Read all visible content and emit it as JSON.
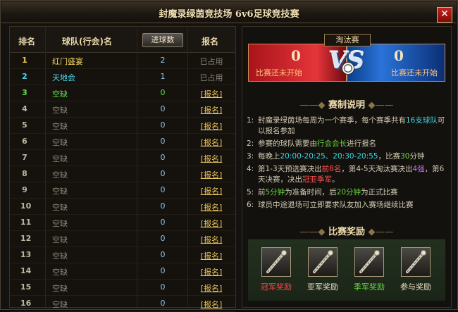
{
  "window": {
    "title": "封魔录绿茵竞技场 6v6足球竞技赛",
    "close_icon": "✕"
  },
  "table": {
    "headers": {
      "rank": "排名",
      "team": "球队(行会)名",
      "goals_btn": "进球数",
      "register": "报名"
    },
    "rows": [
      {
        "rank": "1",
        "team": "红门盛宴",
        "goals": "2",
        "reg": "已占用"
      },
      {
        "rank": "2",
        "team": "天地会",
        "goals": "1",
        "reg": "已占用"
      },
      {
        "rank": "3",
        "team": "空缺",
        "goals": "0",
        "reg": "[报名]"
      },
      {
        "rank": "4",
        "team": "空缺",
        "goals": "0",
        "reg": "[报名]"
      },
      {
        "rank": "5",
        "team": "空缺",
        "goals": "0",
        "reg": "[报名]"
      },
      {
        "rank": "6",
        "team": "空缺",
        "goals": "0",
        "reg": "[报名]"
      },
      {
        "rank": "7",
        "team": "空缺",
        "goals": "0",
        "reg": "[报名]"
      },
      {
        "rank": "8",
        "team": "空缺",
        "goals": "0",
        "reg": "[报名]"
      },
      {
        "rank": "9",
        "team": "空缺",
        "goals": "0",
        "reg": "[报名]"
      },
      {
        "rank": "10",
        "team": "空缺",
        "goals": "0",
        "reg": "[报名]"
      },
      {
        "rank": "11",
        "team": "空缺",
        "goals": "0",
        "reg": "[报名]"
      },
      {
        "rank": "12",
        "team": "空缺",
        "goals": "0",
        "reg": "[报名]"
      },
      {
        "rank": "13",
        "team": "空缺",
        "goals": "0",
        "reg": "[报名]"
      },
      {
        "rank": "14",
        "team": "空缺",
        "goals": "0",
        "reg": "[报名]"
      },
      {
        "rank": "15",
        "team": "空缺",
        "goals": "0",
        "reg": "[报名]"
      },
      {
        "rank": "16",
        "team": "空缺",
        "goals": "0",
        "reg": "[报名]"
      }
    ],
    "colors": {
      "rank1": "#f2c84a",
      "rank2": "#47d3e8",
      "rank3": "#64e04a",
      "team1": "#f0d35e",
      "team2": "#4fd8ec",
      "team3": "#5fe04a",
      "vacant": "#8a8373"
    }
  },
  "match": {
    "stage": "淘汰赛",
    "left_score": "0",
    "right_score": "0",
    "vs": "VS",
    "left_status": "比赛还未开始",
    "right_status": "比赛还未开始"
  },
  "rules": {
    "title": "赛制说明",
    "items": [
      {
        "n": "1:",
        "parts": [
          "封魔录绿茵场每周为一个赛季，每个赛季共有",
          "16支球队",
          "可以报名参加"
        ]
      },
      {
        "n": "2:",
        "parts": [
          "参赛的球队需要由",
          "行会会长",
          "进行报名"
        ]
      },
      {
        "n": "3:",
        "parts": [
          "每晚上",
          "20:00-20:25、20:30-20:55",
          "，比赛",
          "30",
          "分钟"
        ]
      },
      {
        "n": "4:",
        "parts": [
          "第1-3天预选赛决出",
          "前8名",
          "，第4-5天淘汰赛决出",
          "4强",
          "，第6天决赛，决出",
          "冠亚季军",
          "。"
        ]
      },
      {
        "n": "5:",
        "parts": [
          "前",
          "5分钟",
          "为准备时间，后",
          "20分钟",
          "为正式比赛"
        ]
      },
      {
        "n": "6:",
        "parts": [
          "球员中途退场可立即要求队友加入赛场继续比赛"
        ]
      }
    ]
  },
  "rewards": {
    "title": "比赛奖励",
    "items": [
      {
        "label": "冠军奖励",
        "color": "#ff4444",
        "icon": "staff-icon"
      },
      {
        "label": "亚军奖励",
        "color": "#e6dcc0",
        "icon": "staff-icon"
      },
      {
        "label": "季军奖励",
        "color": "#63d63a",
        "icon": "staff-icon"
      },
      {
        "label": "参与奖励",
        "color": "#e6dcc0",
        "icon": "staff-icon"
      }
    ]
  }
}
